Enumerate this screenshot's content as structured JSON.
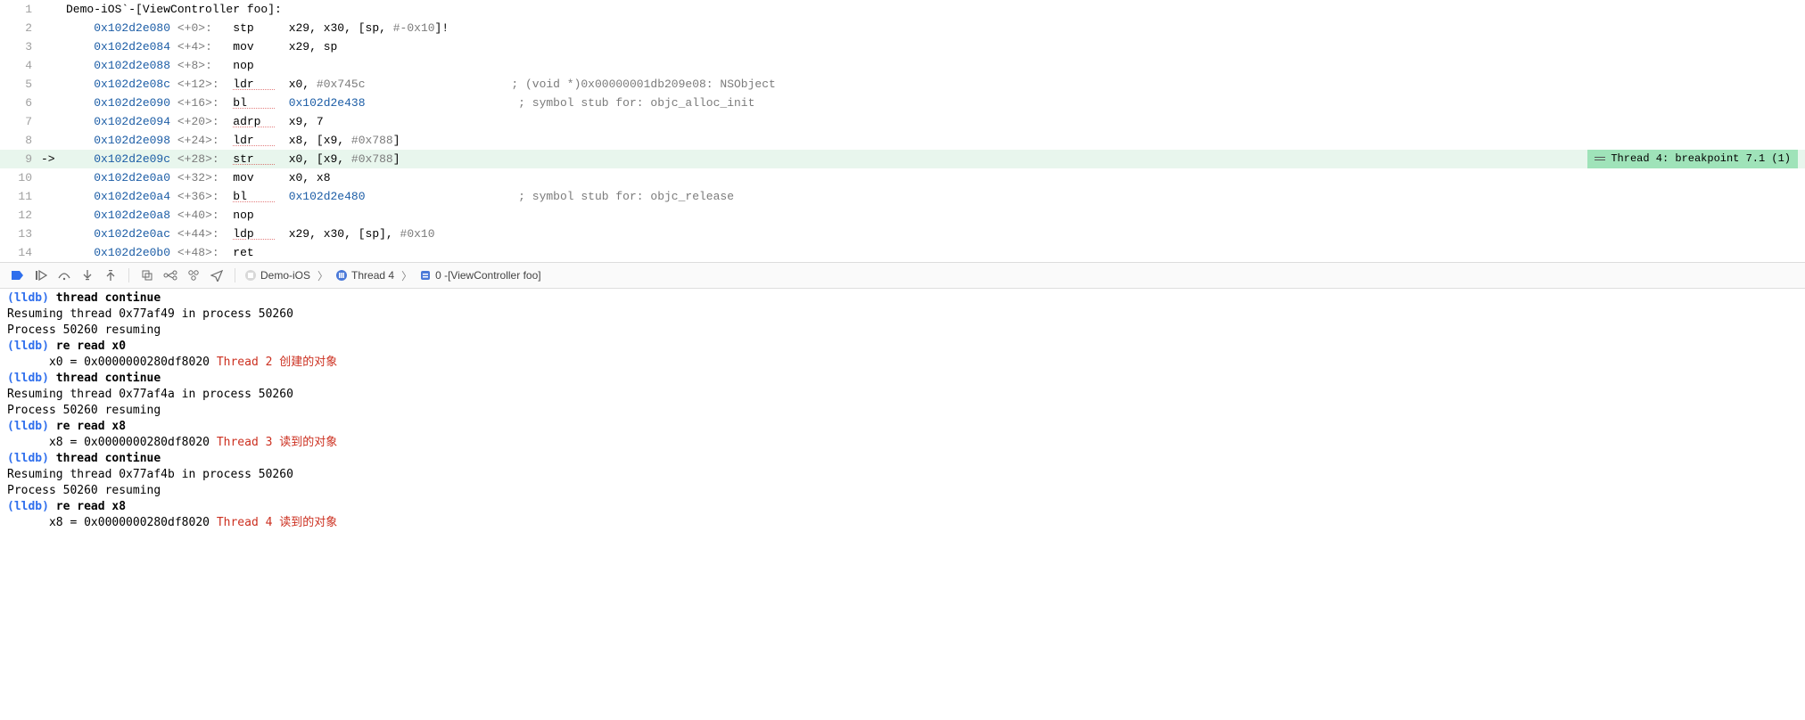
{
  "assembly": {
    "header": "Demo-iOS`-[ViewController foo]:",
    "arrow_line_index": 8,
    "lines": [
      {
        "n": 1
      },
      {
        "n": 2,
        "addr": "0x102d2e080",
        "off": "<+0>:",
        "op": "stp",
        "op_u": false,
        "args": "x29, x30, [sp, ",
        "imm": "#-0x10",
        "tail": "]!",
        "cmt": ""
      },
      {
        "n": 3,
        "addr": "0x102d2e084",
        "off": "<+4>:",
        "op": "mov",
        "op_u": false,
        "args": "x29, sp",
        "imm": "",
        "tail": "",
        "cmt": ""
      },
      {
        "n": 4,
        "addr": "0x102d2e088",
        "off": "<+8>:",
        "op": "nop",
        "op_u": false,
        "args": "",
        "imm": "",
        "tail": "",
        "cmt": ""
      },
      {
        "n": 5,
        "addr": "0x102d2e08c",
        "off": "<+12>:",
        "op": "ldr",
        "op_u": true,
        "args": "x0, ",
        "imm": "#0x745c",
        "tail": "",
        "cmt": "    ; (void *)0x00000001db209e08: NSObject"
      },
      {
        "n": 6,
        "addr": "0x102d2e090",
        "off": "<+16>:",
        "op": "bl",
        "op_u": true,
        "call": "0x102d2e438",
        "cmt": "     ; symbol stub for: objc_alloc_init"
      },
      {
        "n": 7,
        "addr": "0x102d2e094",
        "off": "<+20>:",
        "op": "adrp",
        "op_u": true,
        "args": "x9, 7",
        "imm": "",
        "tail": "",
        "cmt": ""
      },
      {
        "n": 8,
        "addr": "0x102d2e098",
        "off": "<+24>:",
        "op": "ldr",
        "op_u": true,
        "args": "x8, [x9, ",
        "imm": "#0x788",
        "tail": "]",
        "cmt": ""
      },
      {
        "n": 9,
        "addr": "0x102d2e09c",
        "off": "<+28>:",
        "op": "str",
        "op_u": true,
        "args": "x0, [x9, ",
        "imm": "#0x788",
        "tail": "]",
        "cmt": "",
        "hl": true
      },
      {
        "n": 10,
        "addr": "0x102d2e0a0",
        "off": "<+32>:",
        "op": "mov",
        "op_u": false,
        "args": "x0, x8",
        "imm": "",
        "tail": "",
        "cmt": ""
      },
      {
        "n": 11,
        "addr": "0x102d2e0a4",
        "off": "<+36>:",
        "op": "bl",
        "op_u": true,
        "call": "0x102d2e480",
        "cmt": "     ; symbol stub for: objc_release"
      },
      {
        "n": 12,
        "addr": "0x102d2e0a8",
        "off": "<+40>:",
        "op": "nop",
        "op_u": false,
        "args": "",
        "imm": "",
        "tail": "",
        "cmt": ""
      },
      {
        "n": 13,
        "addr": "0x102d2e0ac",
        "off": "<+44>:",
        "op": "ldp",
        "op_u": true,
        "args": "x29, x30, [sp], ",
        "imm": "#0x10",
        "tail": "",
        "cmt": ""
      },
      {
        "n": 14,
        "addr": "0x102d2e0b0",
        "off": "<+48>:",
        "op": "ret",
        "op_u": false,
        "args": "",
        "imm": "",
        "tail": "",
        "cmt": ""
      }
    ],
    "breakpoint_badge": "Thread 4: breakpoint 7.1 (1)"
  },
  "toolbar": {
    "crumbs": [
      "Demo-iOS",
      "Thread 4",
      "0 -[ViewController foo]"
    ]
  },
  "console": {
    "lldb_prompt": "(lldb)",
    "entries": [
      {
        "type": "cmd",
        "text": "thread continue"
      },
      {
        "type": "out",
        "text": "Resuming thread 0x77af49 in process 50260"
      },
      {
        "type": "out",
        "text": "Process 50260 resuming"
      },
      {
        "type": "cmd",
        "text": "re read x0"
      },
      {
        "type": "reg",
        "reg": "x0",
        "val": "0x0000000280df8020",
        "annot": "Thread 2 创建的对象"
      },
      {
        "type": "cmd",
        "text": "thread continue"
      },
      {
        "type": "out",
        "text": "Resuming thread 0x77af4a in process 50260"
      },
      {
        "type": "out",
        "text": "Process 50260 resuming"
      },
      {
        "type": "cmd",
        "text": "re read x8"
      },
      {
        "type": "reg",
        "reg": "x8",
        "val": "0x0000000280df8020",
        "annot": "Thread 3 读到的对象"
      },
      {
        "type": "cmd",
        "text": "thread continue"
      },
      {
        "type": "out",
        "text": "Resuming thread 0x77af4b in process 50260"
      },
      {
        "type": "out",
        "text": "Process 50260 resuming"
      },
      {
        "type": "cmd",
        "text": "re read x8"
      },
      {
        "type": "reg",
        "reg": "x8",
        "val": "0x0000000280df8020",
        "annot": "Thread 4 读到的对象"
      }
    ]
  }
}
